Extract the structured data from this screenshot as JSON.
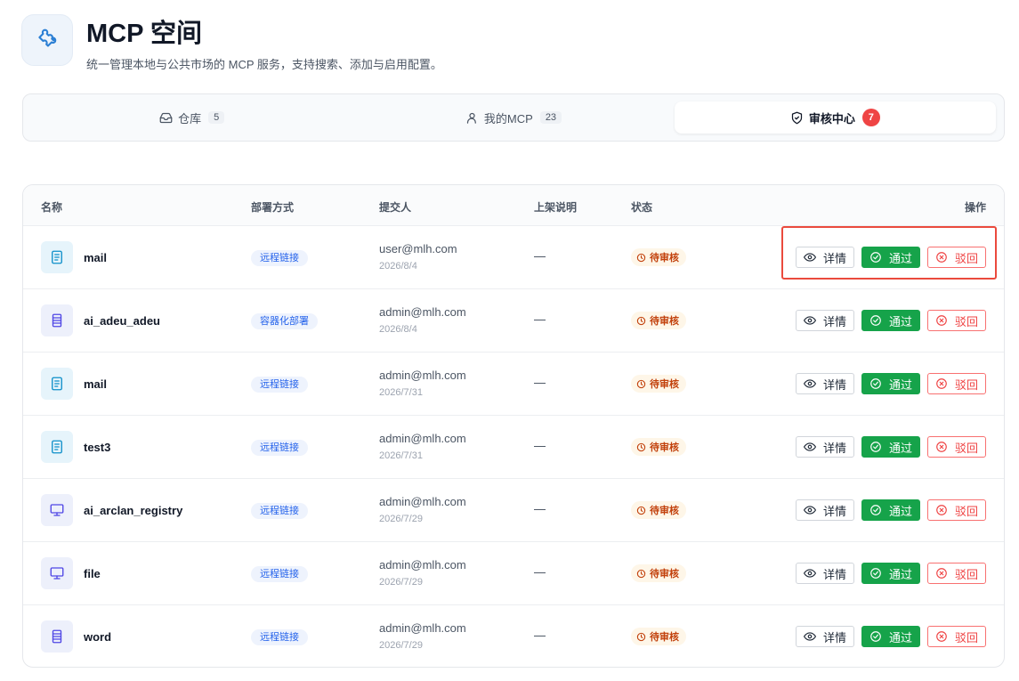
{
  "header": {
    "title": "MCP 空间",
    "subtitle": "统一管理本地与公共市场的 MCP 服务，支持搜索、添加与启用配置。",
    "logo_icon": "puzzle-icon"
  },
  "tabs": [
    {
      "label": "仓库",
      "count": "5",
      "icon": "inbox-icon",
      "active": false
    },
    {
      "label": "我的MCP",
      "count": "23",
      "icon": "user-icon",
      "active": false
    },
    {
      "label": "审核中心",
      "count": "7",
      "icon": "shield-check-icon",
      "active": true
    }
  ],
  "table": {
    "columns": {
      "name": "名称",
      "deploy": "部署方式",
      "submitter": "提交人",
      "note": "上架说明",
      "status": "状态",
      "actions": "操作"
    },
    "actions": {
      "detail": "详情",
      "approve": "通过",
      "reject": "驳回"
    },
    "rows": [
      {
        "name": "mail",
        "icon": "document-icon",
        "deploy": "远程链接",
        "submitter": "user@mlh.com",
        "date": "2026/8/4",
        "note": "—",
        "status": "待审核"
      },
      {
        "name": "ai_adeu_adeu",
        "icon": "server-icon",
        "deploy": "容器化部署",
        "submitter": "admin@mlh.com",
        "date": "2026/8/4",
        "note": "—",
        "status": "待审核"
      },
      {
        "name": "mail",
        "icon": "document-icon",
        "deploy": "远程链接",
        "submitter": "admin@mlh.com",
        "date": "2026/7/31",
        "note": "—",
        "status": "待审核"
      },
      {
        "name": "test3",
        "icon": "document-icon",
        "deploy": "远程链接",
        "submitter": "admin@mlh.com",
        "date": "2026/7/31",
        "note": "—",
        "status": "待审核"
      },
      {
        "name": "ai_arclan_registry",
        "icon": "monitor-icon",
        "deploy": "远程链接",
        "submitter": "admin@mlh.com",
        "date": "2026/7/29",
        "note": "—",
        "status": "待审核"
      },
      {
        "name": "file",
        "icon": "monitor-icon",
        "deploy": "远程链接",
        "submitter": "admin@mlh.com",
        "date": "2026/7/29",
        "note": "—",
        "status": "待审核"
      },
      {
        "name": "word",
        "icon": "server-icon",
        "deploy": "远程链接",
        "submitter": "admin@mlh.com",
        "date": "2026/7/29",
        "note": "—",
        "status": "待审核"
      }
    ]
  },
  "colors": {
    "approve": "#16a34a",
    "reject": "#ef4444",
    "pending": "#c2410c",
    "badge": "#ef4444",
    "highlight": "#ea4a3d"
  }
}
